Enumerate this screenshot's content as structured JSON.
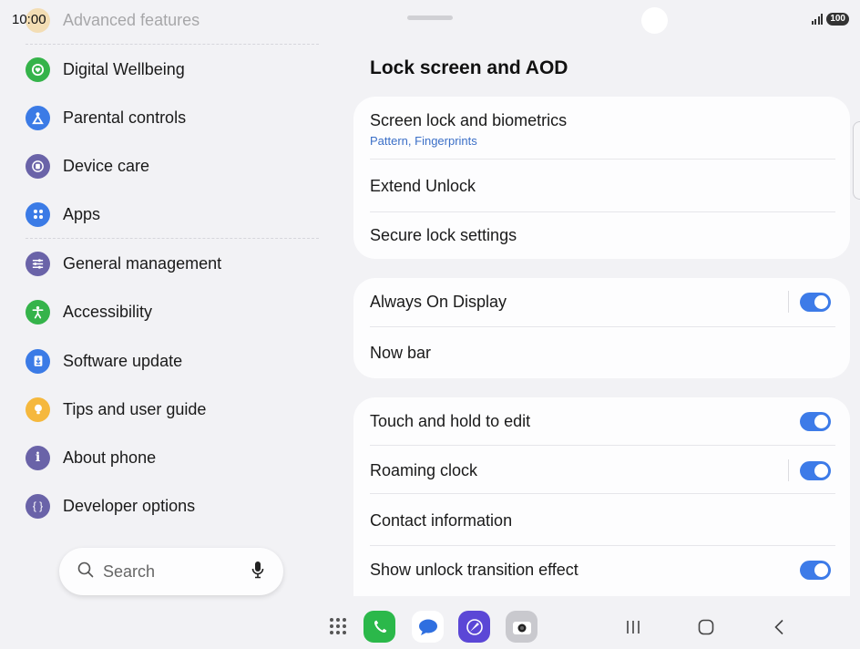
{
  "status": {
    "time": "10:00",
    "battery": "100"
  },
  "left_nav": {
    "faded_item": "Advanced features",
    "items": [
      {
        "label": "Digital Wellbeing",
        "color": "#35b34a"
      },
      {
        "label": "Parental controls",
        "color": "#3b7be6"
      },
      {
        "label": "Device care",
        "color": "#6a63a8"
      },
      {
        "label": "Apps",
        "color": "#3b7be6"
      },
      {
        "label": "General management",
        "color": "#6a63a8"
      },
      {
        "label": "Accessibility",
        "color": "#35b34a"
      },
      {
        "label": "Software update",
        "color": "#3b7be6"
      },
      {
        "label": "Tips and user guide",
        "color": "#f5b83d"
      },
      {
        "label": "About phone",
        "color": "#6a63a8"
      },
      {
        "label": "Developer options",
        "color": "#6a63a8"
      }
    ],
    "search_label": "Search"
  },
  "main": {
    "title": "Lock screen and AOD",
    "card1": {
      "screen_lock": "Screen lock and biometrics",
      "screen_lock_sub": "Pattern, Fingerprints",
      "extend_unlock": "Extend Unlock",
      "secure_lock": "Secure lock settings"
    },
    "card2": {
      "aod": "Always On Display",
      "aod_on": true,
      "now_bar": "Now bar"
    },
    "card3": {
      "touch_hold": "Touch and hold to edit",
      "touch_hold_on": true,
      "roaming_clock": "Roaming clock",
      "roaming_clock_on": true,
      "contact_info": "Contact information",
      "unlock_effect": "Show unlock transition effect",
      "unlock_effect_on": true
    }
  },
  "colors": {
    "accent": "#3d7be8",
    "link": "#3b6fc7"
  },
  "dock": {
    "apps": [
      "phone-icon",
      "messages-icon",
      "internet-icon",
      "camera-icon"
    ]
  }
}
